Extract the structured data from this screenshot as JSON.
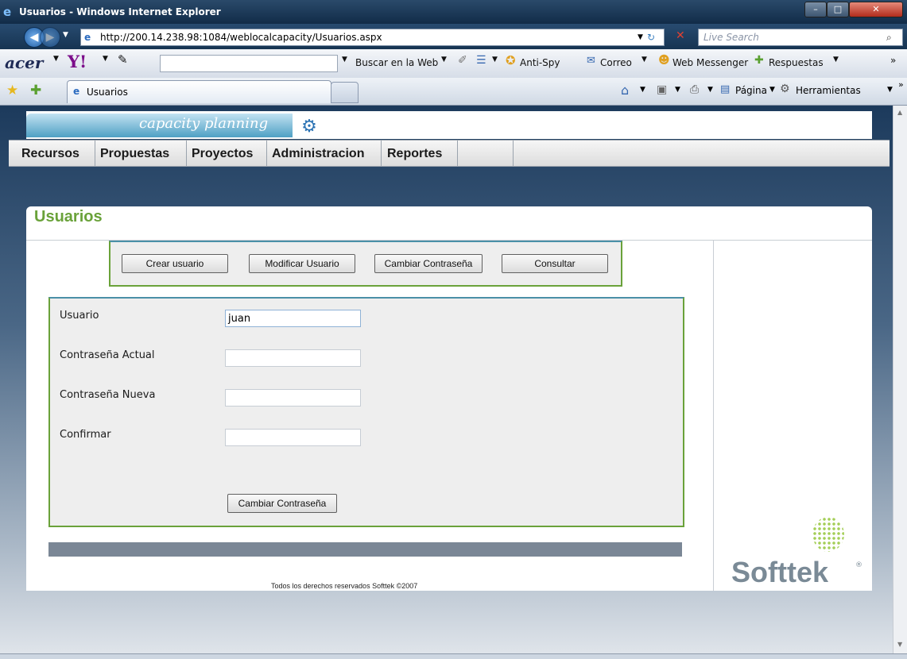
{
  "window": {
    "title": "Usuarios - Windows Internet Explorer"
  },
  "address_bar": {
    "url": "http://200.14.238.98:1084/weblocalcapacity/Usuarios.aspx",
    "search_placeholder": "Live Search"
  },
  "toolbar": {
    "acer": "acer",
    "yahoo": "Y!",
    "search_web": "Buscar en la Web",
    "anti_spy": "Anti-Spy",
    "mail": "Correo",
    "messenger": "Web Messenger",
    "answers": "Respuestas"
  },
  "tabs": {
    "active": "Usuarios",
    "page_menu": "Página",
    "tools_menu": "Herramientas"
  },
  "site": {
    "logo_text": "capacity planning",
    "menu": [
      "Recursos",
      "Propuestas",
      "Proyectos",
      "Administracion",
      "Reportes"
    ]
  },
  "page": {
    "title": "Usuarios",
    "actions": [
      "Crear usuario",
      "Modificar Usuario",
      "Cambiar Contraseña",
      "Consultar"
    ],
    "form": {
      "user_label": "Usuario",
      "user_value": "juan",
      "current_password_label": "Contraseña Actual",
      "new_password_label": "Contraseña Nueva",
      "confirm_label": "Confirmar",
      "submit_label": "Cambiar Contraseña"
    },
    "footer": "Todos los derechos reservados Softtek ©2007",
    "brand": "Softtek",
    "brand_mark": "®"
  },
  "colors": {
    "accent_green": "#6aa23a",
    "menu_bg": "#dcdcdc",
    "footer_bar": "#7b8796"
  }
}
